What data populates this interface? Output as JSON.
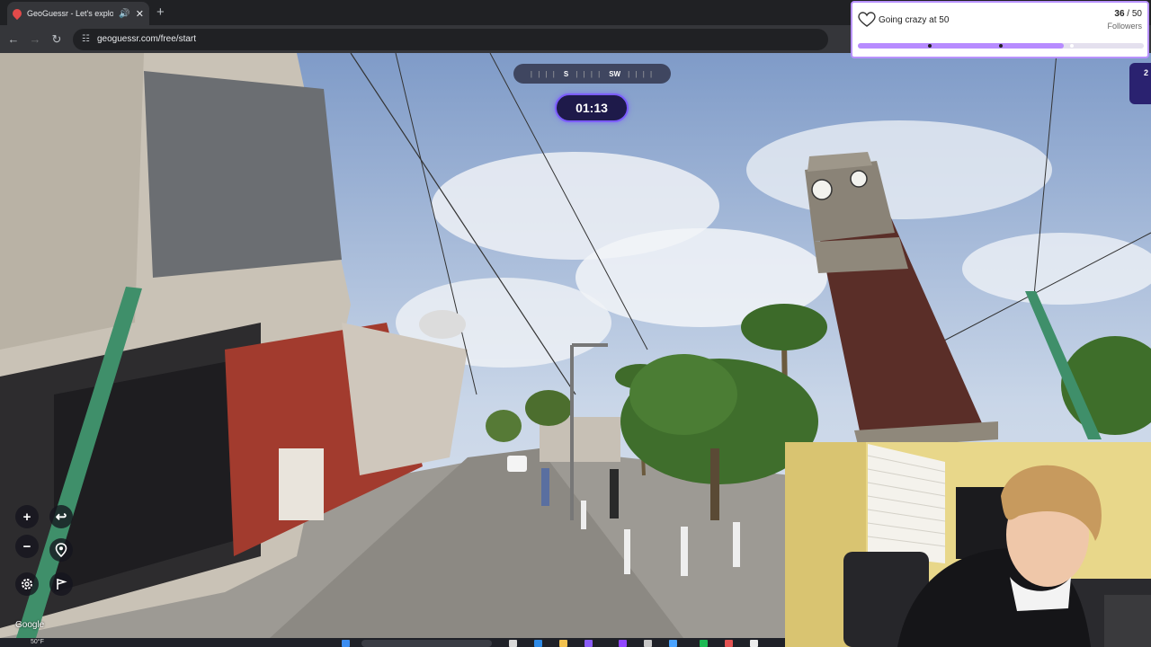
{
  "browser": {
    "tab_title": "GeoGuessr - Let's explore the world",
    "audio_icon": "speaker-icon",
    "close_icon": "close-icon",
    "new_tab": "+",
    "url": "geoguessr.com/free/start"
  },
  "game": {
    "compass": {
      "left": "S",
      "right": "SW",
      "ticks": "| | | |"
    },
    "timer": "01:13",
    "controls": {
      "zoom_in": "+",
      "zoom_out": "−",
      "undo": "↩",
      "location": "location-pin-icon",
      "settings": "gear-icon",
      "checkpoint": "flag-icon"
    },
    "attribution": "Google"
  },
  "goal_widget": {
    "title": "Going crazy at 50",
    "current": "36",
    "sep": " / ",
    "target": "50",
    "unit": "Followers",
    "progress": 0.72,
    "accent": "#b78bff"
  },
  "side_badge": {
    "text": "2"
  },
  "taskbar": {
    "temperature": "50°F"
  },
  "colors": {
    "timer_border": "#7b5cff",
    "chrome": "#202124"
  }
}
